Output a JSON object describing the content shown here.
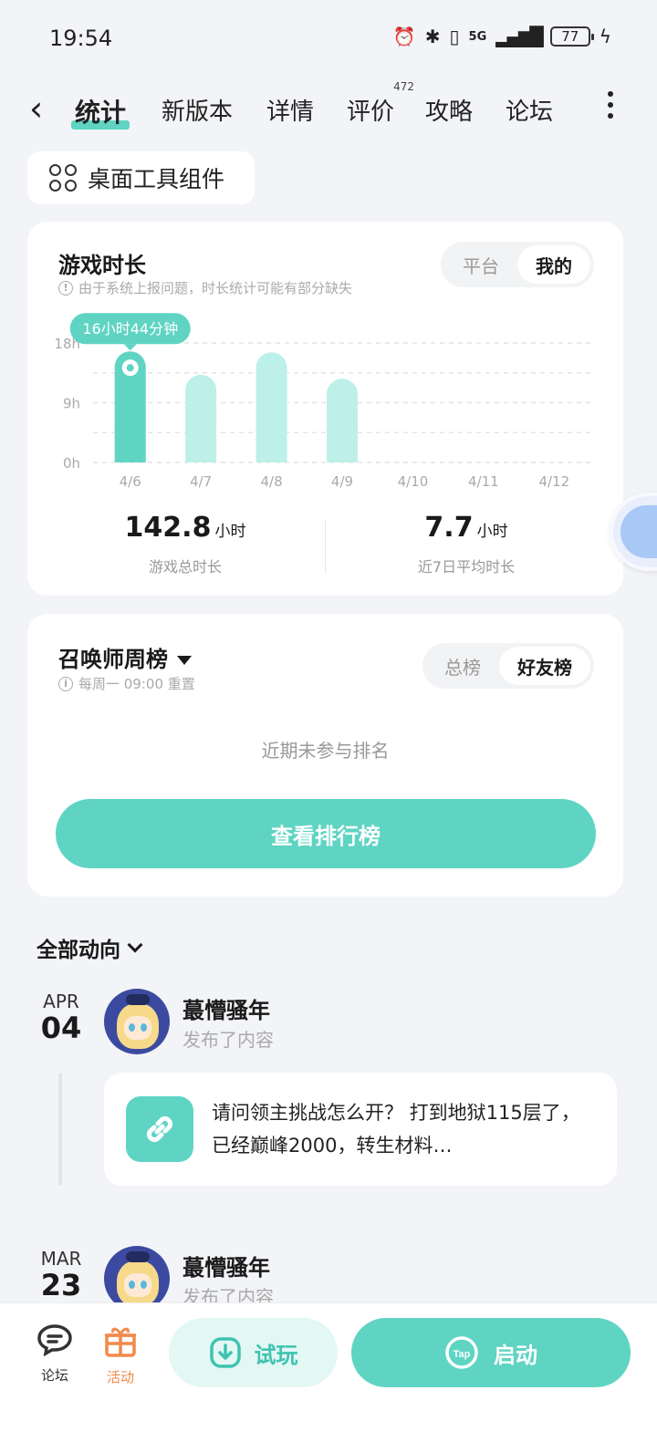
{
  "status": {
    "time": "19:54",
    "battery": "77",
    "network": "5G"
  },
  "nav": {
    "tabs": [
      "统计",
      "新版本",
      "详情",
      "评价",
      "攻略",
      "论坛"
    ],
    "review_count": "472"
  },
  "widget_chip": {
    "label": "桌面工具组件"
  },
  "playtime": {
    "title": "游戏时长",
    "hint": "由于系统上报问题，时长统计可能有部分缺失",
    "toggle": [
      "平台",
      "我的"
    ],
    "tooltip": "16小时44分钟",
    "total_value": "142.8",
    "total_unit": "小时",
    "total_label": "游戏总时长",
    "avg_value": "7.7",
    "avg_unit": "小时",
    "avg_label": "近7日平均时长"
  },
  "chart_data": {
    "type": "bar",
    "categories": [
      "4/6",
      "4/7",
      "4/8",
      "4/9",
      "4/10",
      "4/11",
      "4/12"
    ],
    "values": [
      16.73,
      13.2,
      16.6,
      12.6,
      0,
      0,
      0
    ],
    "ylabel": "",
    "yticks": [
      "0h",
      "9h",
      "18h"
    ],
    "ylim": [
      0,
      18
    ],
    "highlight_index": 0,
    "colors": {
      "highlight": "#5fd4c3",
      "normal": "#bdf0e8"
    }
  },
  "ranking": {
    "title": "召唤师周榜",
    "hint": "每周一 09:00 重置",
    "toggle": [
      "总榜",
      "好友榜"
    ],
    "empty": "近期未参与排名",
    "button": "查看排行榜"
  },
  "feed": {
    "header": "全部动向",
    "items": [
      {
        "mon": "APR",
        "day": "04",
        "user": "蕞懵骚年",
        "action": "发布了内容",
        "text": "请问领主挑战怎么开？ 打到地狱115层了，已经巅峰2000，转生材料…"
      },
      {
        "mon": "MAR",
        "day": "23",
        "user": "蕞懵骚年",
        "action": "发布了内容"
      }
    ]
  },
  "bottom": {
    "forum": "论坛",
    "activity": "活动",
    "try": "试玩",
    "start": "启动",
    "tap_logo": "Tap"
  },
  "colors": {
    "accent": "#5fd4c3",
    "activity": "#f08a4b"
  }
}
